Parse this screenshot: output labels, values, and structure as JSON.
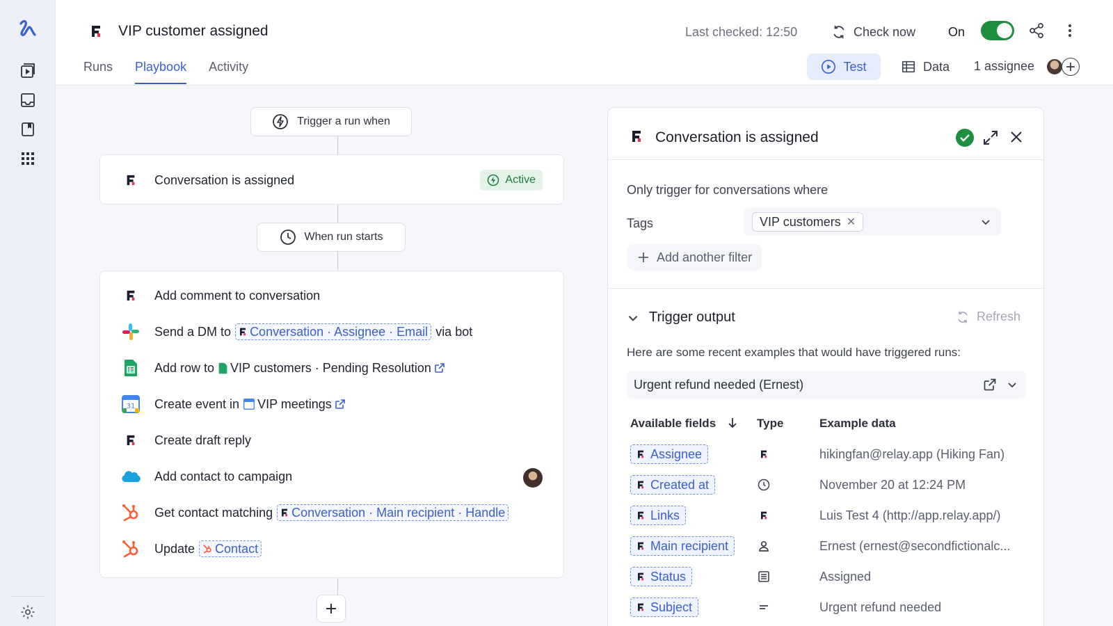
{
  "workflow": {
    "title": "VIP customer assigned",
    "last_checked": "Last checked: 12:50",
    "check_now": "Check now",
    "on_label": "On",
    "tabs": [
      "Runs",
      "Playbook",
      "Activity"
    ],
    "test": "Test",
    "data": "Data",
    "assignee": "1 assignee"
  },
  "playbook": {
    "trigger_pill": "Trigger a run when",
    "trigger_step": "Conversation is assigned",
    "active_badge": "Active",
    "start_pill": "When run starts",
    "steps": {
      "s1": "Add comment to conversation",
      "s2_prefix": "Send a DM to",
      "s2_token": "Conversation · Assignee · Email",
      "s2_suffix": "via bot",
      "s3_prefix": "Add row to",
      "s3_ref": "VIP customers · Pending Resolution",
      "s4_prefix": "Create event in",
      "s4_ref": "VIP meetings",
      "s4_cal_day": "31",
      "s5": "Create draft reply",
      "s6": "Add contact to campaign",
      "s7_prefix": "Get contact matching",
      "s7_token": "Conversation · Main recipient · Handle",
      "s8_prefix": "Update",
      "s8_token": "Contact"
    }
  },
  "panel": {
    "title": "Conversation is assigned",
    "only_trigger": "Only trigger for conversations where",
    "tags_label": "Tags",
    "tag_chip": "VIP customers",
    "tag_remove": "✕",
    "add_filter": "Add another filter",
    "trigger_output": "Trigger output",
    "refresh": "Refresh",
    "recent": "Here are some recent examples that would have triggered runs:",
    "example": "Urgent refund needed (Ernest)",
    "col_fields": "Available fields",
    "col_type": "Type",
    "col_example": "Example data",
    "fields": [
      {
        "name": "Assignee",
        "type_icon": "front-icon",
        "example": "hikingfan@relay.app (Hiking Fan)"
      },
      {
        "name": "Created at",
        "type_icon": "clock-icon",
        "example": "November 20 at 12:24 PM"
      },
      {
        "name": "Links",
        "type_icon": "front-icon",
        "example": "Luis Test 4 (http://app.relay.app/)"
      },
      {
        "name": "Main recipient",
        "type_icon": "person-icon",
        "example": "Ernest (ernest@secondfictionalc..."
      },
      {
        "name": "Status",
        "type_icon": "list-icon",
        "example": "Assigned"
      },
      {
        "name": "Subject",
        "type_icon": "text-icon",
        "example": "Urgent refund needed"
      }
    ]
  },
  "colors": {
    "accent": "#3a5fcf",
    "toggle_on": "#1e8f3e",
    "front_brand": "#e8335a"
  }
}
